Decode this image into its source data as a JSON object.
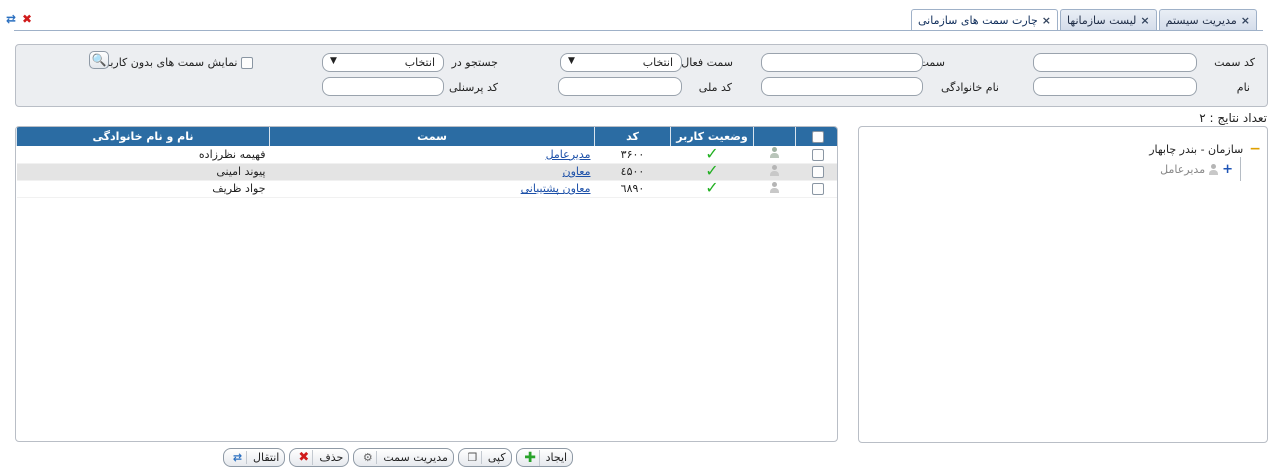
{
  "toolbar": {
    "refresh_icon": "refresh-icon",
    "close_icon": "close-icon"
  },
  "tabs": [
    {
      "label": "مدیریت سیستم",
      "close": "×"
    },
    {
      "label": "لیست سازمانها",
      "close": "×"
    },
    {
      "label": "چارت سمت های سازمانی",
      "close": "×"
    }
  ],
  "search": {
    "code_label": "کد سمت",
    "position_label": "سمت",
    "active_position_label": "سمت فعال",
    "active_position_value": "انتخاب",
    "search_in_label": "جستجو در",
    "search_in_value": "انتخاب",
    "show_no_user_label": "نمایش سمت های بدون کاربر",
    "first_name_label": "نام",
    "last_name_label": "نام خانوادگی",
    "national_code_label": "کد ملی",
    "personnel_code_label": "کد پرسنلی",
    "search_icon": "🔍"
  },
  "results_count": "تعداد نتایج : ۲",
  "tree": {
    "root_label": "سازمان - بندر چابهار",
    "child_label": "مدیرعامل"
  },
  "grid": {
    "headers": [
      "",
      "",
      "وضعیت کاربر",
      "کد",
      "سمت",
      "نام و نام خانوادگی"
    ],
    "rows": [
      {
        "status": "✓",
        "code": "۳۶۰۰",
        "position": "مدیرعامل",
        "name": "فهیمه نظرزاده"
      },
      {
        "status": "✓",
        "code": "٤۵۰۰",
        "position": "معاون",
        "name": "پیوند امینی"
      },
      {
        "status": "✓",
        "code": "٦۸۹۰",
        "position": "معاون پشتیبانی",
        "name": "جواد ظریف"
      }
    ]
  },
  "buttons": {
    "create": "ایجاد",
    "copy": "کپی",
    "manage_position": "مدیریت سمت",
    "delete": "حذف",
    "transfer": "انتقال"
  }
}
